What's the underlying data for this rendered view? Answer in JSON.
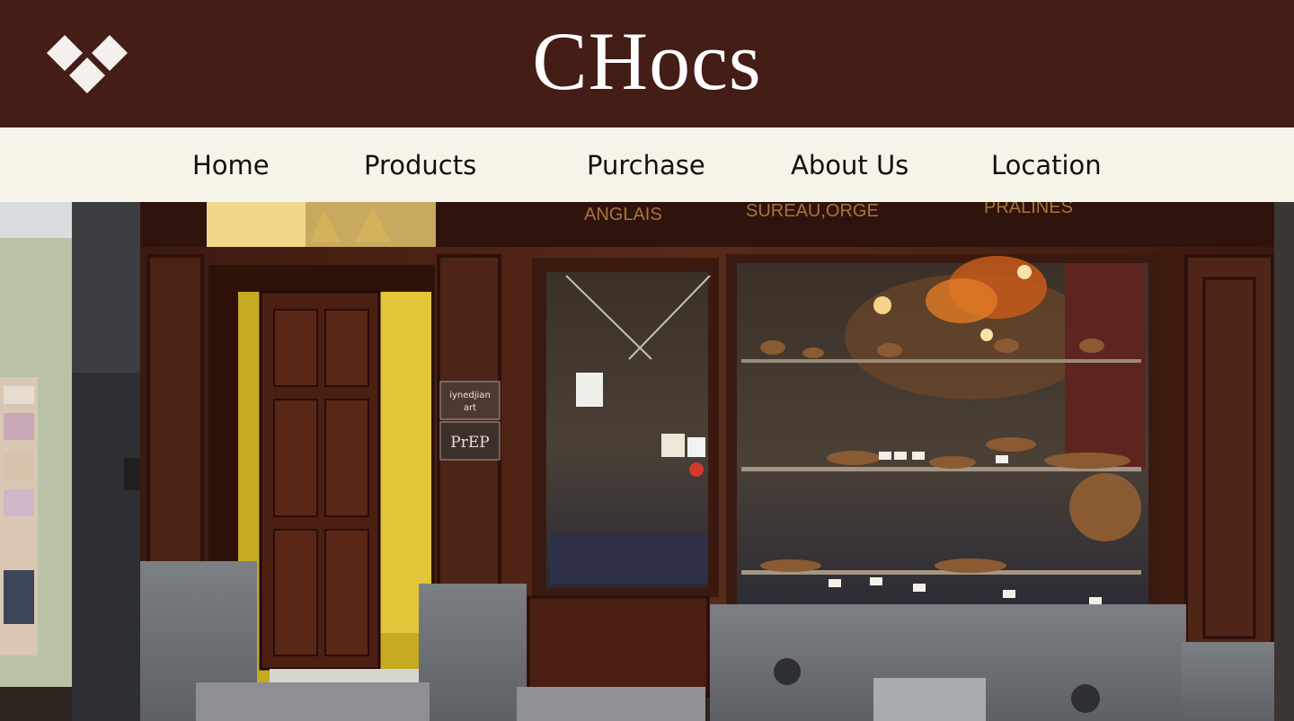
{
  "header": {
    "logo_icon": "diamond-cluster-icon",
    "brand": "CHocs",
    "background": "#441d16"
  },
  "nav": {
    "background": "#f6f3e8",
    "items": [
      {
        "label": "Home"
      },
      {
        "label": "Products"
      },
      {
        "label": "Purchase"
      },
      {
        "label": "About Us"
      },
      {
        "label": "Location"
      }
    ]
  },
  "hero": {
    "sign_words": [
      "ANGLAIS",
      "SUREAU,ORGE",
      "PRALINES"
    ],
    "plaque_lines": [
      "iynedjian",
      "art",
      "PrEP"
    ]
  }
}
